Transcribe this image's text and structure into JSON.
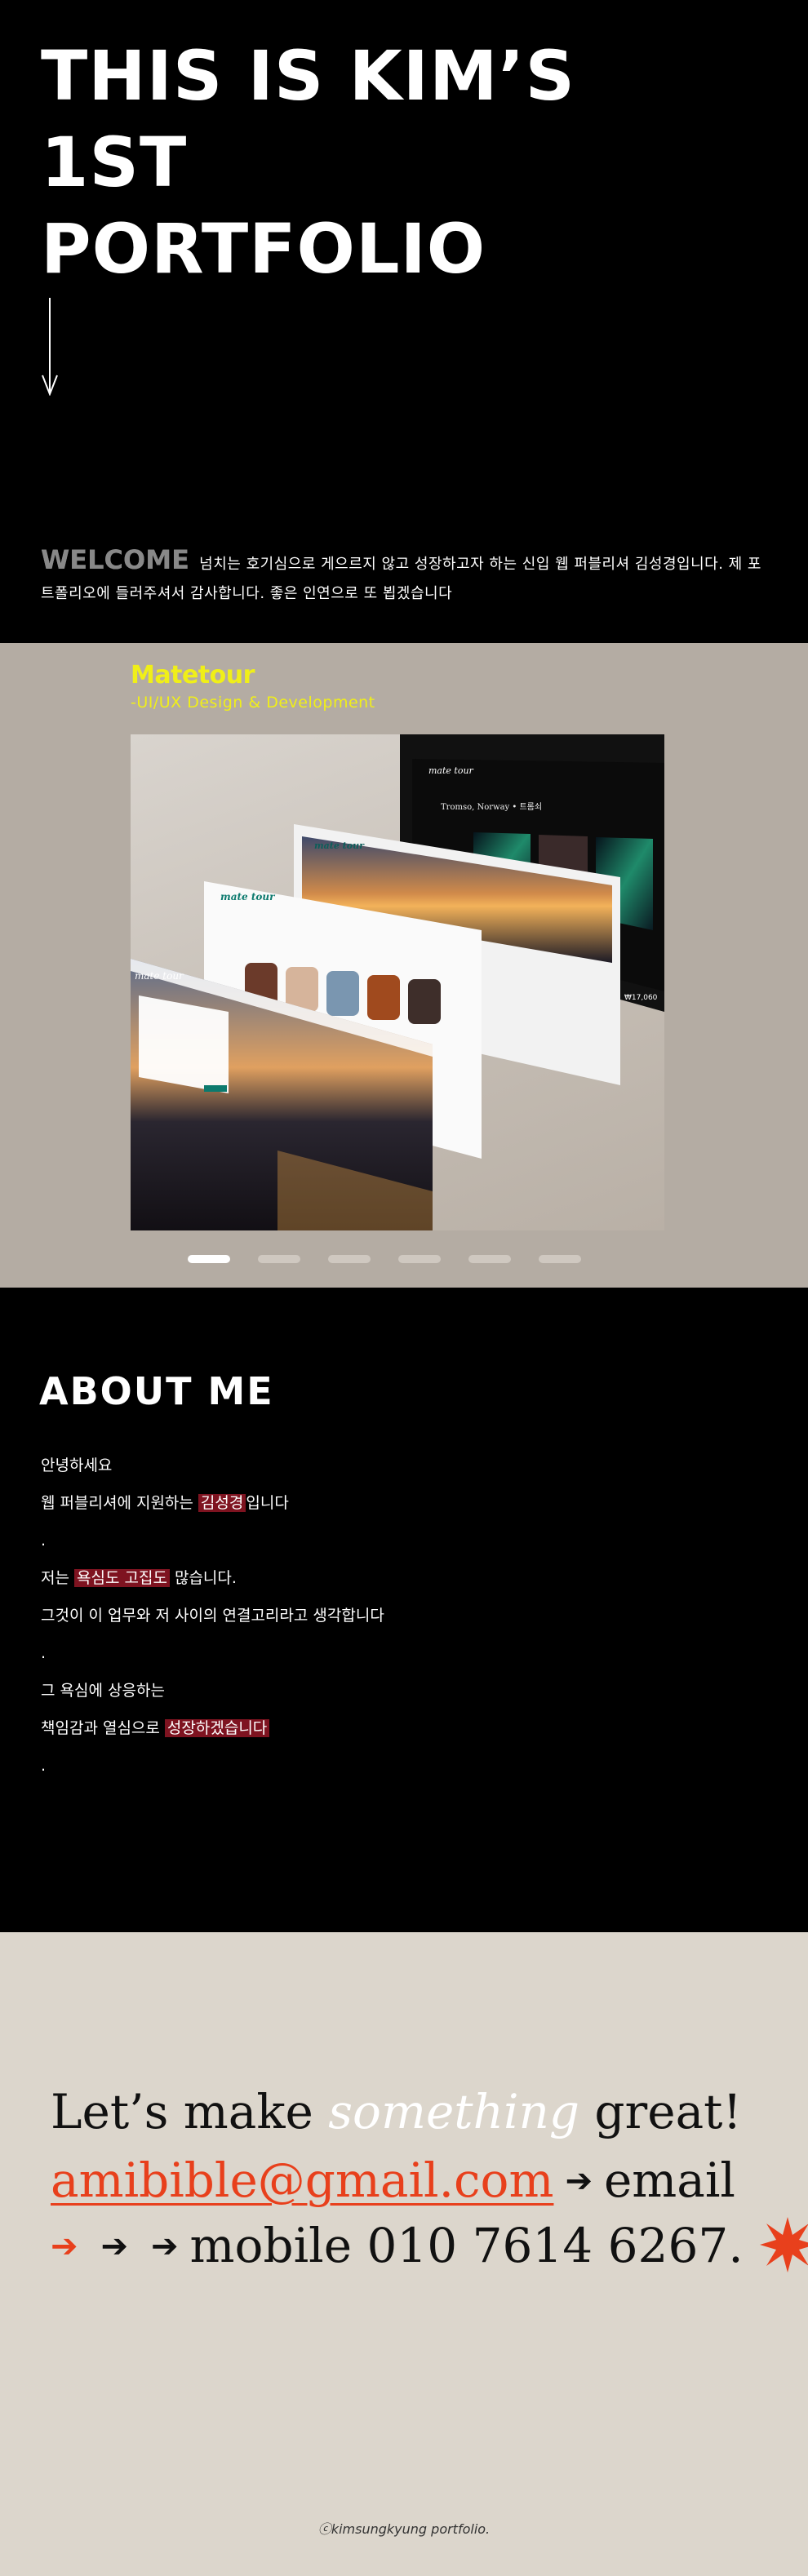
{
  "hero": {
    "title": "THIS IS KIM’S\n1ST\nPORTFOLIO",
    "welcome_word": "WELCOME",
    "welcome_text": "넘치는 호기심으로 게으르지 않고 성장하고자 하는  신입 웹 퍼블리셔 김성경입니다.  제 포트폴리오에 들러주셔서 감사합니다. 좋은 인연으로 또 뵙겠습니다"
  },
  "project": {
    "title": "Matetour",
    "subtitle": "-UI/UX Design & Development",
    "mockup_brand": "mate tour",
    "mockup_heading": "Tromso, Norway • 트롬쇠",
    "mockup_price": "₩17,060",
    "slide_count": 6,
    "active_slide": 1,
    "accent": "#f0ef18"
  },
  "about": {
    "title": "ABOUT ME",
    "l1": "안녕하세요",
    "l2a": "웹 퍼블리셔에 지원하는 ",
    "l2h": "김성경",
    "l2b": "입니다",
    "l3": ".",
    "l4a": "저는 ",
    "l4h": "욕심도 고집도",
    "l4b": " 많습니다.",
    "l5": "그것이 이 업무와 저 사이의 연결고리라고 생각합니다",
    "l6": ".",
    "l7": "그 욕심에 상응하는",
    "l8a": "책임감과 열심으로 ",
    "l8h": "성장하겠습니다",
    "l9": "."
  },
  "contact": {
    "line1_a": "Let’s make ",
    "line1_b": "something",
    "line1_c": " great!",
    "email": "amibible@gmail.com",
    "email_label": "email",
    "mobile_label": "mobile 010 7614 6267.",
    "accent": "#e8401c"
  },
  "footer": {
    "text": "ⓒkimsungkyung portfolio."
  }
}
